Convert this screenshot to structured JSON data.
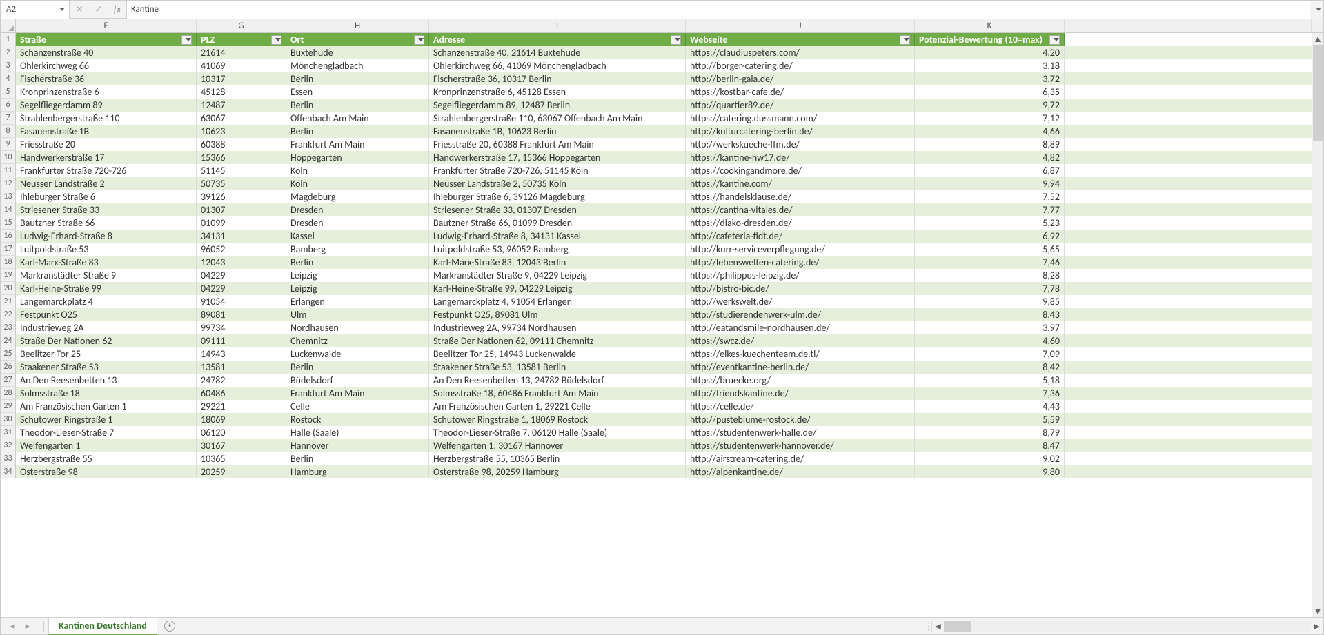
{
  "formula_bar": {
    "cell_ref": "A2",
    "fx_label": "fx",
    "value": "Kantine"
  },
  "col_letters": [
    "F",
    "G",
    "H",
    "I",
    "J",
    "K"
  ],
  "headers": {
    "F": "Straße",
    "G": "PLZ",
    "H": "Ort",
    "I": "Adresse",
    "J": "Webseite",
    "K": "Potenzial-Bewertung (10=max)"
  },
  "rows": [
    {
      "n": 2,
      "F": "Schanzenstraße 40",
      "G": "21614",
      "H": "Buxtehude",
      "I": "Schanzenstraße 40, 21614 Buxtehude",
      "J": "https://claudiuspeters.com/",
      "K": "4,20"
    },
    {
      "n": 3,
      "F": "Ohlerkirchweg 66",
      "G": "41069",
      "H": "Mönchengladbach",
      "I": "Ohlerkirchweg 66, 41069 Mönchengladbach",
      "J": "http://borger-catering.de/",
      "K": "3,18"
    },
    {
      "n": 4,
      "F": "Fischerstraße 36",
      "G": "10317",
      "H": "Berlin",
      "I": "Fischerstraße 36, 10317 Berlin",
      "J": "http://berlin-gala.de/",
      "K": "3,72"
    },
    {
      "n": 5,
      "F": "Kronprinzenstraße 6",
      "G": "45128",
      "H": "Essen",
      "I": "Kronprinzenstraße 6, 45128 Essen",
      "J": "https://kostbar-cafe.de/",
      "K": "6,35"
    },
    {
      "n": 6,
      "F": "Segelfliegerdamm 89",
      "G": "12487",
      "H": "Berlin",
      "I": "Segelfliegerdamm 89, 12487 Berlin",
      "J": "http://quartier89.de/",
      "K": "9,72"
    },
    {
      "n": 7,
      "F": "Strahlenbergerstraße 110",
      "G": "63067",
      "H": "Offenbach Am Main",
      "I": "Strahlenbergerstraße 110, 63067 Offenbach Am Main",
      "J": "https://catering.dussmann.com/",
      "K": "7,12"
    },
    {
      "n": 8,
      "F": "Fasanenstraße 1B",
      "G": "10623",
      "H": "Berlin",
      "I": "Fasanenstraße 1B, 10623 Berlin",
      "J": "http://kulturcatering-berlin.de/",
      "K": "4,66"
    },
    {
      "n": 9,
      "F": "Friesstraße 20",
      "G": "60388",
      "H": "Frankfurt Am Main",
      "I": "Friesstraße 20, 60388 Frankfurt Am Main",
      "J": "http://werkskueche-ffm.de/",
      "K": "8,89"
    },
    {
      "n": 10,
      "F": "Handwerkerstraße 17",
      "G": "15366",
      "H": "Hoppegarten",
      "I": "Handwerkerstraße 17, 15366 Hoppegarten",
      "J": "https://kantine-hw17.de/",
      "K": "4,82"
    },
    {
      "n": 11,
      "F": "Frankfurter Straße 720-726",
      "G": "51145",
      "H": "Köln",
      "I": "Frankfurter Straße 720-726, 51145 Köln",
      "J": "https://cookingandmore.de/",
      "K": "6,87"
    },
    {
      "n": 12,
      "F": "Neusser Landstraße 2",
      "G": "50735",
      "H": "Köln",
      "I": "Neusser Landstraße 2, 50735 Köln",
      "J": "https://kantine.com/",
      "K": "9,94"
    },
    {
      "n": 13,
      "F": "Ihleburger Straße 6",
      "G": "39126",
      "H": "Magdeburg",
      "I": "Ihleburger Straße 6, 39126 Magdeburg",
      "J": "https://handelsklause.de/",
      "K": "7,52"
    },
    {
      "n": 14,
      "F": "Striesener Straße 33",
      "G": "01307",
      "H": "Dresden",
      "I": "Striesener Straße 33, 01307 Dresden",
      "J": "https://cantina-vitales.de/",
      "K": "7,77"
    },
    {
      "n": 15,
      "F": "Bautzner Straße 66",
      "G": "01099",
      "H": "Dresden",
      "I": "Bautzner Straße 66, 01099 Dresden",
      "J": "https://diako-dresden.de/",
      "K": "5,23"
    },
    {
      "n": 16,
      "F": "Ludwig-Erhard-Straße 8",
      "G": "34131",
      "H": "Kassel",
      "I": "Ludwig-Erhard-Straße 8, 34131 Kassel",
      "J": "http://cafeteria-fidt.de/",
      "K": "6,92"
    },
    {
      "n": 17,
      "F": "Luitpoldstraße 53",
      "G": "96052",
      "H": "Bamberg",
      "I": "Luitpoldstraße 53, 96052 Bamberg",
      "J": "http://kurr-serviceverpflegung.de/",
      "K": "5,65"
    },
    {
      "n": 18,
      "F": "Karl-Marx-Straße 83",
      "G": "12043",
      "H": "Berlin",
      "I": "Karl-Marx-Straße 83, 12043 Berlin",
      "J": "http://lebenswelten-catering.de/",
      "K": "7,46"
    },
    {
      "n": 19,
      "F": "Markranstädter Straße 9",
      "G": "04229",
      "H": "Leipzig",
      "I": "Markranstädter Straße 9, 04229 Leipzig",
      "J": "https://philippus-leipzig.de/",
      "K": "8,28"
    },
    {
      "n": 20,
      "F": "Karl-Heine-Straße 99",
      "G": "04229",
      "H": "Leipzig",
      "I": "Karl-Heine-Straße 99, 04229 Leipzig",
      "J": "http://bistro-bic.de/",
      "K": "7,78"
    },
    {
      "n": 21,
      "F": "Langemarckplatz 4",
      "G": "91054",
      "H": "Erlangen",
      "I": "Langemarckplatz 4, 91054 Erlangen",
      "J": "http://werkswelt.de/",
      "K": "9,85"
    },
    {
      "n": 22,
      "F": "Festpunkt O25",
      "G": "89081",
      "H": "Ulm",
      "I": "Festpunkt O25, 89081 Ulm",
      "J": "http://studierendenwerk-ulm.de/",
      "K": "8,43"
    },
    {
      "n": 23,
      "F": "Industrieweg 2A",
      "G": "99734",
      "H": "Nordhausen",
      "I": "Industrieweg 2A, 99734 Nordhausen",
      "J": "http://eatandsmile-nordhausen.de/",
      "K": "3,97"
    },
    {
      "n": 24,
      "F": "Straße Der Nationen 62",
      "G": "09111",
      "H": "Chemnitz",
      "I": "Straße Der Nationen 62, 09111 Chemnitz",
      "J": "https://swcz.de/",
      "K": "4,60"
    },
    {
      "n": 25,
      "F": "Beelitzer Tor 25",
      "G": "14943",
      "H": "Luckenwalde",
      "I": "Beelitzer Tor 25, 14943 Luckenwalde",
      "J": "https://elkes-kuechenteam.de.tl/",
      "K": "7,09"
    },
    {
      "n": 26,
      "F": "Staakener Straße 53",
      "G": "13581",
      "H": "Berlin",
      "I": "Staakener Straße 53, 13581 Berlin",
      "J": "http://eventkantine-berlin.de/",
      "K": "8,42"
    },
    {
      "n": 27,
      "F": "An Den Reesenbetten 13",
      "G": "24782",
      "H": "Büdelsdorf",
      "I": "An Den Reesenbetten 13, 24782 Büdelsdorf",
      "J": "https://bruecke.org/",
      "K": "5,18"
    },
    {
      "n": 28,
      "F": "Solmsstraße 18",
      "G": "60486",
      "H": "Frankfurt Am Main",
      "I": "Solmsstraße 18, 60486 Frankfurt Am Main",
      "J": "http://friendskantine.de/",
      "K": "7,36"
    },
    {
      "n": 29,
      "F": "Am Französischen Garten 1",
      "G": "29221",
      "H": "Celle",
      "I": "Am Französischen Garten 1, 29221 Celle",
      "J": "https://celle.de/",
      "K": "4,43"
    },
    {
      "n": 30,
      "F": "Schutower Ringstraße 1",
      "G": "18069",
      "H": "Rostock",
      "I": "Schutower Ringstraße 1, 18069 Rostock",
      "J": "http://pusteblume-rostock.de/",
      "K": "5,59"
    },
    {
      "n": 31,
      "F": "Theodor-Lieser-Straße 7",
      "G": "06120",
      "H": "Halle (Saale)",
      "I": "Theodor-Lieser-Straße 7, 06120 Halle (Saale)",
      "J": "https://studentenwerk-halle.de/",
      "K": "8,79"
    },
    {
      "n": 32,
      "F": "Welfengarten 1",
      "G": "30167",
      "H": "Hannover",
      "I": "Welfengarten 1, 30167 Hannover",
      "J": "https://studentenwerk-hannover.de/",
      "K": "8,47"
    },
    {
      "n": 33,
      "F": "Herzbergstraße 55",
      "G": "10365",
      "H": "Berlin",
      "I": "Herzbergstraße 55, 10365 Berlin",
      "J": "http://airstream-catering.de/",
      "K": "9,02"
    },
    {
      "n": 34,
      "F": "Osterstraße 98",
      "G": "20259",
      "H": "Hamburg",
      "I": "Osterstraße 98, 20259 Hamburg",
      "J": "http://alpenkantine.de/",
      "K": "9,80"
    }
  ],
  "sheet_bar": {
    "active_tab": "Kantinen Deutschland"
  }
}
